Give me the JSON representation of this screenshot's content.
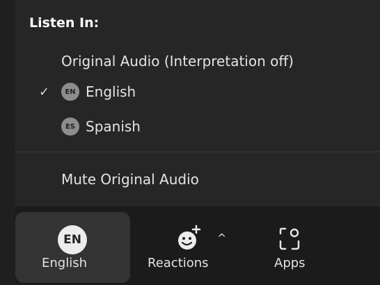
{
  "menu": {
    "title": "Listen In:",
    "items": [
      {
        "label": "Original Audio (Interpretation off)",
        "checked": false
      },
      {
        "label": "English",
        "badge": "EN",
        "checked": true
      },
      {
        "label": "Spanish",
        "badge": "ES",
        "checked": false
      }
    ],
    "check_glyph": "✓",
    "mute_label": "Mute Original Audio"
  },
  "toolbar": {
    "language": {
      "badge": "EN",
      "label": "English"
    },
    "reactions": {
      "label": "Reactions",
      "icon": "smiley-add-icon"
    },
    "apps": {
      "label": "Apps",
      "icon": "apps-icon"
    },
    "caret_glyph": "^"
  },
  "colors": {
    "menu_bg": "#262626",
    "toolbar_bg": "#1b1b1b",
    "active_button_bg": "#333333",
    "badge_bg": "#8d8d8d"
  }
}
